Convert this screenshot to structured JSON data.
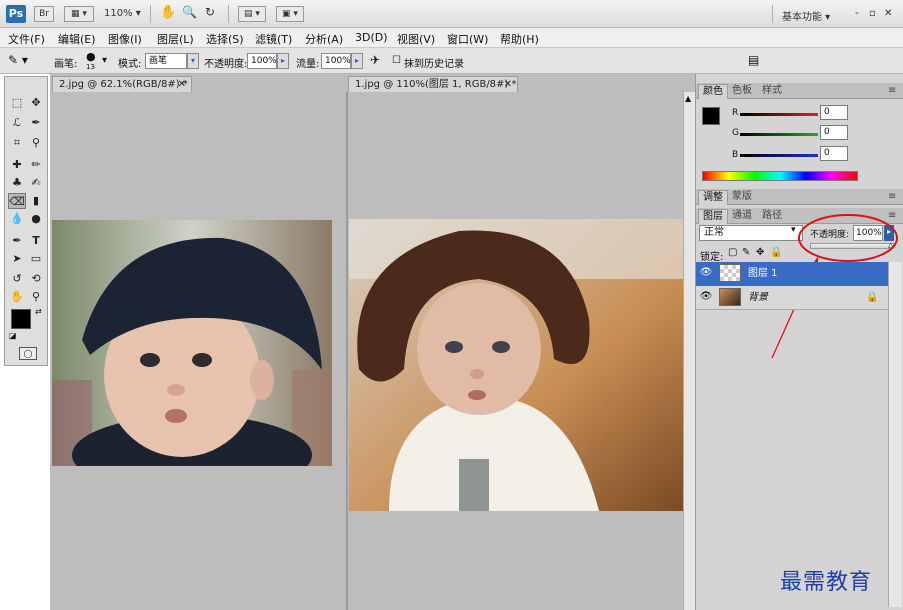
{
  "appbar": {
    "logo": "Ps",
    "bridge": "Br",
    "zoom": "110%",
    "workspace": "基本功能",
    "window_controls": [
      "-",
      "▫",
      "✕"
    ]
  },
  "menu": [
    "文件(F)",
    "编辑(E)",
    "图像(I)",
    "图层(L)",
    "选择(S)",
    "滤镜(T)",
    "分析(A)",
    "3D(D)",
    "视图(V)",
    "窗口(W)",
    "帮助(H)"
  ],
  "options": {
    "brush_label": "画笔:",
    "brush_size": "13",
    "mode_label": "模式:",
    "mode_value": "画笔",
    "opacity_label": "不透明度:",
    "opacity_value": "100%",
    "flow_label": "流量:",
    "flow_value": "100%",
    "erase_history": "抹到历史记录"
  },
  "documents": [
    {
      "tab": "2.jpg @ 62.1%(RGB/8#) *",
      "close": "✕"
    },
    {
      "tab": "1.jpg @ 110%(图层 1, RGB/8#) *",
      "close": "✕"
    }
  ],
  "color_panel": {
    "tabs": [
      "颜色",
      "色板",
      "样式"
    ],
    "channels": [
      {
        "label": "R",
        "value": "0",
        "color": "#e02020"
      },
      {
        "label": "G",
        "value": "0",
        "color": "#20b020"
      },
      {
        "label": "B",
        "value": "0",
        "color": "#2030d0"
      }
    ]
  },
  "adjust_tabs": [
    "调整",
    "蒙版"
  ],
  "layers_panel": {
    "tabs": [
      "图层",
      "通道",
      "路径"
    ],
    "blend_mode": "正常",
    "opacity_label": "不透明度:",
    "opacity_value": "100%",
    "lock_label": "锁定:",
    "layers": [
      {
        "name": "图层 1",
        "selected": true
      },
      {
        "name": "背景",
        "selected": false
      }
    ]
  },
  "watermark": "最需教育",
  "annotation_color": "#e01010"
}
